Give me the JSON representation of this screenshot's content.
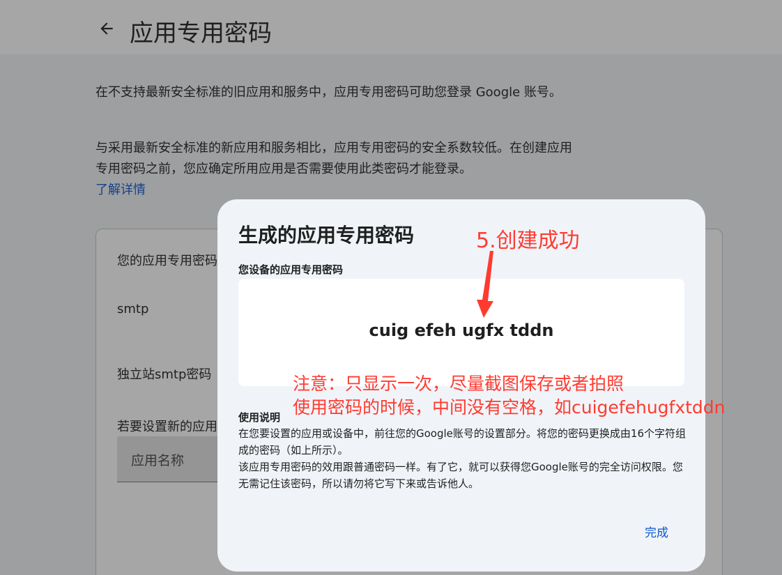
{
  "header": {
    "back_icon": "arrow-back-icon",
    "title": "应用专用密码"
  },
  "intro": {
    "para1": "在不支持最新安全标准的旧应用和服务中，应用专用密码可助您登录 Google 账号。",
    "para2": "与采用最新安全标准的新应用和服务相比，应用专用密码的安全系数较低。在创建应用专用密码之前，您应确定所用应用是否需要使用此类密码才能登录。",
    "learn_more": "了解详情"
  },
  "card": {
    "heading": "您的应用专用密码",
    "app1": "smtp",
    "app2": "独立站smtp密码",
    "hint": "若要设置新的应用专用密码",
    "app_name_placeholder": "应用名称"
  },
  "dialog": {
    "title": "生成的应用专用密码",
    "subtitle": "您设备的应用专用密码",
    "password": "cuig efeh ugfx tddn",
    "usage_title": "使用说明",
    "usage_p1": "在您要设置的应用或设备中，前往您的Google账号的设置部分。将您的密码更换成由16个字符组成的密码（如上所示）。",
    "usage_p2": "该应用专用密码的效用跟普通密码一样。有了它，就可以获得您Google账号的完全访问权限。您无需记住该密码，所以请勿将它写下来或告诉他人。",
    "done_label": "完成"
  },
  "annotations": {
    "step": "5.创建成功",
    "note_line1": "注意：只显示一次，尽量截图保存或者拍照",
    "note_line2": "使用密码的时候，中间没有空格，如cuigefehugfxtddn",
    "color": "#ff3b30"
  },
  "colors": {
    "accent": "#0b57d0",
    "dialog_bg": "#f0f4f9",
    "scrim": "rgba(32,33,36,0.40)"
  }
}
